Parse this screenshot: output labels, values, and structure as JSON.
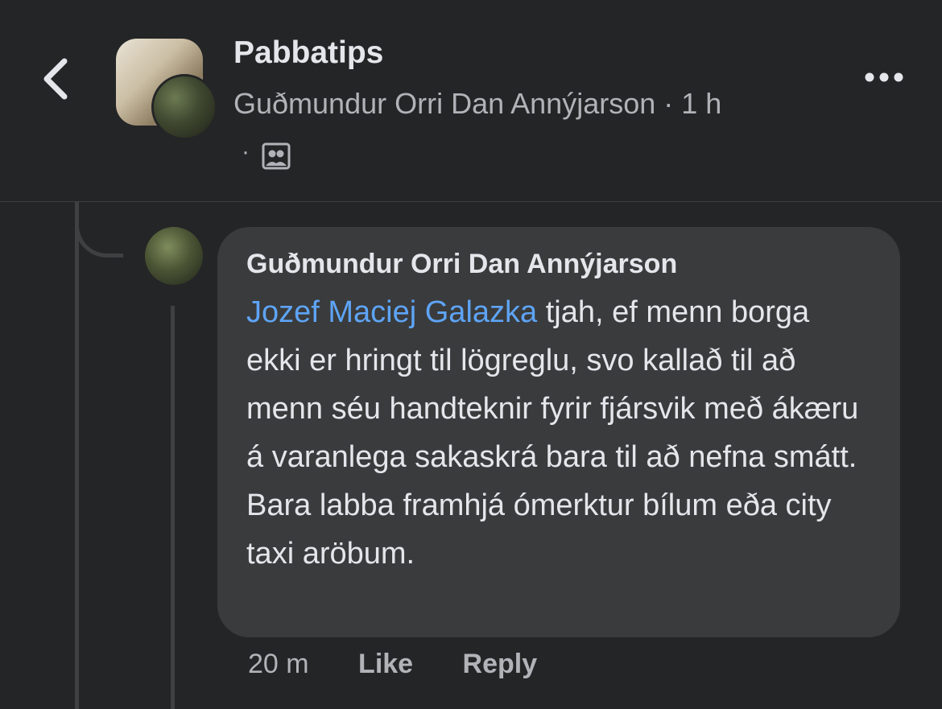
{
  "header": {
    "group_name": "Pabbatips",
    "author": "Guðmundur Orri Dan Annýjarson",
    "separator": "·",
    "time": "1 h",
    "audience_dot": "·"
  },
  "comment": {
    "author": "Guðmundur Orri Dan Annýjarson",
    "mention": "Jozef Maciej Galazka",
    "text": " tjah, ef menn borga ekki er hringt til lögreglu, svo kallað til að menn séu handteknir fyrir fjársvik með ákæru á varanlega sakaskrá bara til að nefna smátt. Bara labba framhjá ómerktur bílum eða city taxi aröbum.",
    "time": "20 m",
    "like_label": "Like",
    "reply_label": "Reply"
  },
  "colors": {
    "background": "#242526",
    "bubble": "#3a3b3c",
    "mention": "#5ea4f6",
    "secondary_text": "#b0b3b8"
  },
  "icons": [
    "back-chevron-icon",
    "more-options-icon",
    "audience-group-icon"
  ]
}
